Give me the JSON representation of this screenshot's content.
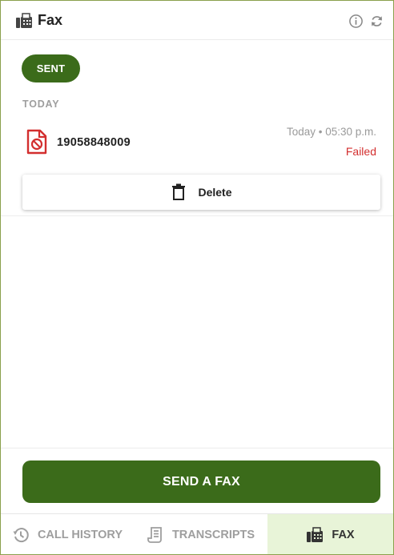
{
  "header": {
    "title": "Fax",
    "title_icon": "fax-machine-icon",
    "info_icon": "info-icon",
    "refresh_icon": "refresh-icon"
  },
  "filter": {
    "active_label": "SENT"
  },
  "sections": [
    {
      "label": "TODAY",
      "items": [
        {
          "icon": "fax-document-failed-icon",
          "number": "19058848009",
          "time": "Today • 05:30 p.m.",
          "status": "Failed",
          "delete_label": "Delete"
        }
      ]
    }
  ],
  "action": {
    "send_label": "SEND A FAX"
  },
  "nav": {
    "tabs": [
      {
        "label": "CALL HISTORY",
        "icon": "history-icon",
        "active": false
      },
      {
        "label": "TRANSCRIPTS",
        "icon": "transcript-icon",
        "active": false
      },
      {
        "label": "FAX",
        "icon": "fax-machine-icon",
        "active": true
      }
    ]
  },
  "colors": {
    "brand_green": "#3b6b1a",
    "active_tab_bg": "#e8f4d8",
    "failed_red": "#d32f2f"
  }
}
